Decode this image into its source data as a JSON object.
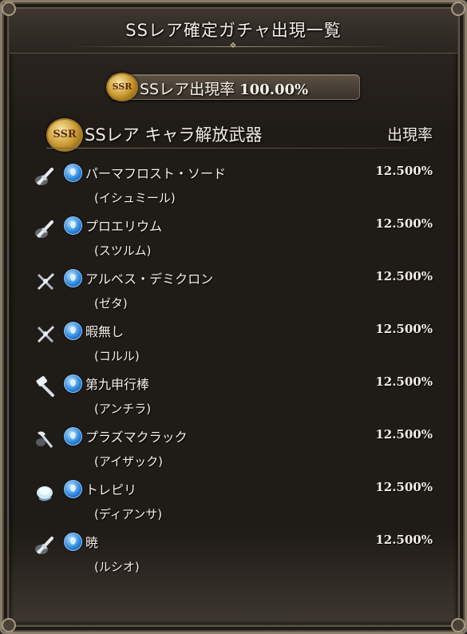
{
  "dialog": {
    "title": "SSレア確定ガチャ出現一覧",
    "rate_summary": {
      "badge": "SSR",
      "label": "SSレア出現率",
      "value": "100.00%"
    },
    "section": {
      "badge": "SSR",
      "title": "SSレア キャラ解放武器",
      "rate_header": "出現率"
    }
  },
  "items": [
    {
      "name": "パーマフロスト・ソード",
      "character": "(イシュミール)",
      "rate": "12.500%",
      "weapon_icon": "sword-icon",
      "element": "water"
    },
    {
      "name": "プロエリウム",
      "character": "(スツルム)",
      "rate": "12.500%",
      "weapon_icon": "sword-icon",
      "element": "water"
    },
    {
      "name": "アルベス・デミクロン",
      "character": "(ゼタ)",
      "rate": "12.500%",
      "weapon_icon": "spear-icon",
      "element": "water"
    },
    {
      "name": "暇無し",
      "character": "(コルル)",
      "rate": "12.500%",
      "weapon_icon": "spear-icon",
      "element": "water"
    },
    {
      "name": "第九申行棒",
      "character": "(アンチラ)",
      "rate": "12.500%",
      "weapon_icon": "staff-icon",
      "element": "water"
    },
    {
      "name": "プラズマクラック",
      "character": "(アイザック)",
      "rate": "12.500%",
      "weapon_icon": "axe-icon",
      "element": "water"
    },
    {
      "name": "トレピリ",
      "character": "(ディアンサ)",
      "rate": "12.500%",
      "weapon_icon": "harp-icon",
      "element": "water"
    },
    {
      "name": "暁",
      "character": "(ルシオ)",
      "rate": "12.500%",
      "weapon_icon": "sword-icon",
      "element": "water"
    }
  ]
}
